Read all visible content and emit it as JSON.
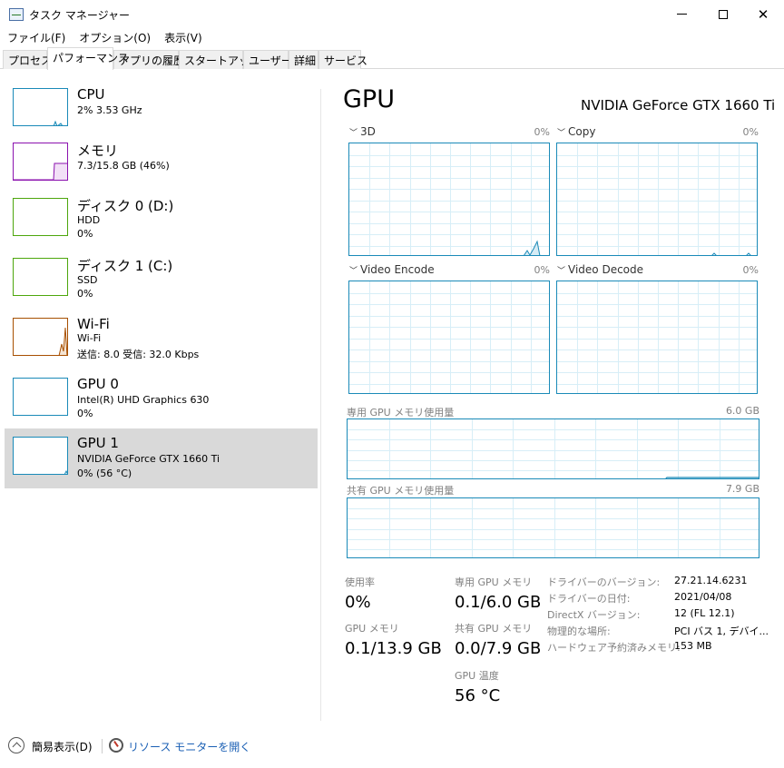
{
  "window": {
    "title": "タスク マネージャー",
    "controls": {
      "minimize": "",
      "maximize": "",
      "close": "✕"
    }
  },
  "menu": [
    "ファイル(F)",
    "オプション(O)",
    "表示(V)"
  ],
  "tabs": [
    "プロセス",
    "パフォーマンス",
    "アプリの履歴",
    "スタートアップ",
    "ユーザー",
    "詳細",
    "サービス"
  ],
  "active_tab": "パフォーマンス",
  "resources": [
    {
      "title": "CPU",
      "lines": [
        "2% 3.53 GHz"
      ],
      "color": "#1a8ab8"
    },
    {
      "title": "メモリ",
      "lines": [
        "7.3/15.8 GB (46%)"
      ],
      "color": "#8b12ae"
    },
    {
      "title": "ディスク 0 (D:)",
      "lines": [
        "HDD",
        "0%"
      ],
      "color": "#4da60c"
    },
    {
      "title": "ディスク 1 (C:)",
      "lines": [
        "SSD",
        "0%"
      ],
      "color": "#4da60c"
    },
    {
      "title": "Wi-Fi",
      "lines": [
        "Wi-Fi",
        "送信: 8.0 受信: 32.0 Kbps"
      ],
      "color": "#a74f01"
    },
    {
      "title": "GPU 0",
      "lines": [
        "Intel(R) UHD Graphics 630",
        "0%"
      ],
      "color": "#1a8ab8"
    },
    {
      "title": "GPU 1",
      "lines": [
        "NVIDIA GeForce GTX 1660 Ti",
        "0% (56 °C)"
      ],
      "color": "#1a8ab8",
      "selected": true
    }
  ],
  "detail": {
    "title": "GPU",
    "device_name": "NVIDIA GeForce GTX 1660 Ti",
    "engines": [
      {
        "name": "3D",
        "percent": "0%"
      },
      {
        "name": "Copy",
        "percent": "0%"
      },
      {
        "name": "Video Encode",
        "percent": "0%"
      },
      {
        "name": "Video Decode",
        "percent": "0%"
      }
    ],
    "dedicated_memory": {
      "label": "専用 GPU メモリ使用量",
      "max": "6.0 GB"
    },
    "shared_memory": {
      "label": "共有 GPU メモリ使用量",
      "max": "7.9 GB"
    },
    "stats": {
      "utilization": {
        "label": "使用率",
        "value": "0%"
      },
      "gpu_memory": {
        "label": "GPU メモリ",
        "value": "0.1/13.9 GB"
      },
      "dedicated": {
        "label": "専用 GPU メモリ",
        "value": "0.1/6.0 GB"
      },
      "shared": {
        "label": "共有 GPU メモリ",
        "value": "0.0/7.9 GB"
      },
      "temperature": {
        "label": "GPU 温度",
        "value": "56 °C"
      }
    },
    "info": [
      {
        "label": "ドライバーのバージョン:",
        "value": "27.21.14.6231"
      },
      {
        "label": "ドライバーの日付:",
        "value": "2021/04/08"
      },
      {
        "label": "DirectX バージョン:",
        "value": "12 (FL 12.1)"
      },
      {
        "label": "物理的な場所:",
        "value": "PCI バス 1, デバイ..."
      },
      {
        "label": "ハードウェア予約済みメモリ:",
        "value": "153 MB"
      }
    ]
  },
  "footer": {
    "simple_view": "簡易表示(D)",
    "resource_monitor": "リソース モニターを開く"
  },
  "colors": {
    "graph_border": "#1a8ab8",
    "grid": "#d7eef7",
    "selected_bg": "#d9d9d9",
    "link": "#1a5fb4"
  }
}
